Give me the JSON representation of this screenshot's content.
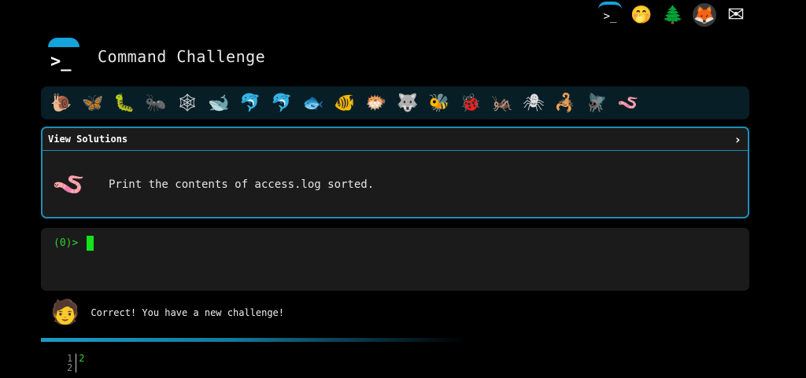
{
  "topbar": {
    "icons": [
      {
        "name": "terminal-logo-icon",
        "glyph": ">_"
      },
      {
        "name": "shushing-face-icon",
        "glyph": "🤭"
      },
      {
        "name": "tree-icon",
        "glyph": "🌲"
      },
      {
        "name": "gitlab-icon",
        "glyph": "🦊"
      },
      {
        "name": "mail-icon",
        "glyph": "✉"
      }
    ]
  },
  "header": {
    "title": "Command Challenge",
    "logo_glyph": ">_"
  },
  "creatures": [
    "🐌",
    "🦋",
    "🐛",
    "🐜",
    "🕸",
    "🐋",
    "🐬",
    "🐬",
    "🐟",
    "🐠",
    "🐡",
    "🐺",
    "🐝",
    "🐞",
    "🦗",
    "🕷",
    "🦂",
    "🪰",
    "🪱"
  ],
  "solutions": {
    "label": "View Solutions",
    "chevron": "›",
    "worm_glyph": "🪱",
    "task": "Print the contents of access.log sorted."
  },
  "terminal": {
    "prompt": "(0)>"
  },
  "status": {
    "avatar_glyph": "🧑",
    "message": "Correct! You have a new challenge!"
  },
  "output": {
    "line_numbers": [
      "1",
      "2"
    ],
    "lines": [
      "2",
      ""
    ]
  },
  "colors": {
    "accent": "#1b8fb6",
    "prompt_green": "#2fd12f"
  }
}
